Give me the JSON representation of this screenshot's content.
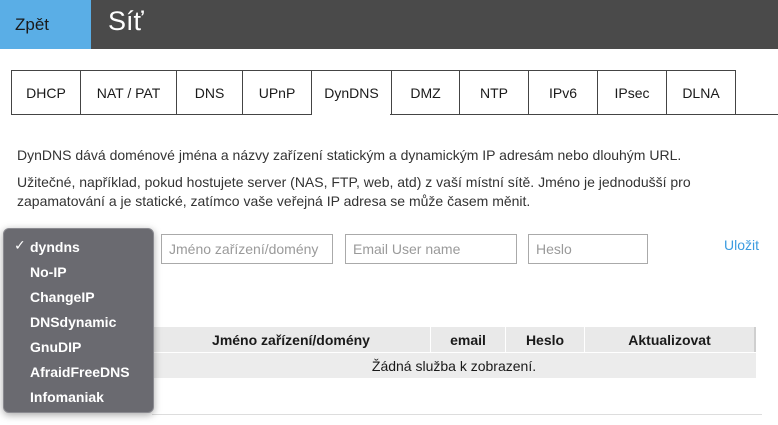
{
  "header": {
    "back_label": "Zpět",
    "title": "Síť"
  },
  "tabs": [
    {
      "label": "DHCP"
    },
    {
      "label": "NAT / PAT"
    },
    {
      "label": "DNS"
    },
    {
      "label": "UPnP"
    },
    {
      "label": "DynDNS",
      "active": true
    },
    {
      "label": "DMZ"
    },
    {
      "label": "NTP"
    },
    {
      "label": "IPv6"
    },
    {
      "label": "IPsec"
    },
    {
      "label": "DLNA"
    }
  ],
  "description": {
    "line1": "DynDNS dává doménové jména a názvy zařízení statickým a dynamickým IP adresám nebo dlouhým URL.",
    "line2": "Užitečné, například, pokud hostujete server (NAS, FTP, web, atd) z vaší místní sítě. Jméno je jednodušší pro zapamatování a je statické, zatímco vaše veřejná IP adresa se může časem měnit."
  },
  "form": {
    "device_placeholder": "Jméno zařízení/domény",
    "email_placeholder": "Email User name",
    "password_placeholder": "Heslo",
    "save_label": "Uložit"
  },
  "provider_dropdown": {
    "selected": "dyndns",
    "check_icon": "✓",
    "options": [
      "dyndns",
      "No-IP",
      "ChangeIP",
      "DNSdynamic",
      "GnuDIP",
      "AfraidFreeDNS",
      "Infomaniak"
    ]
  },
  "table": {
    "columns": [
      "Jméno zařízení/domény",
      "email",
      "Heslo",
      "Aktualizovat"
    ],
    "empty_message": "Žádná služba k zobrazení."
  },
  "colors": {
    "accent": "#5aaee6",
    "header_bg": "#4a4a4a",
    "link": "#3b9be0"
  }
}
